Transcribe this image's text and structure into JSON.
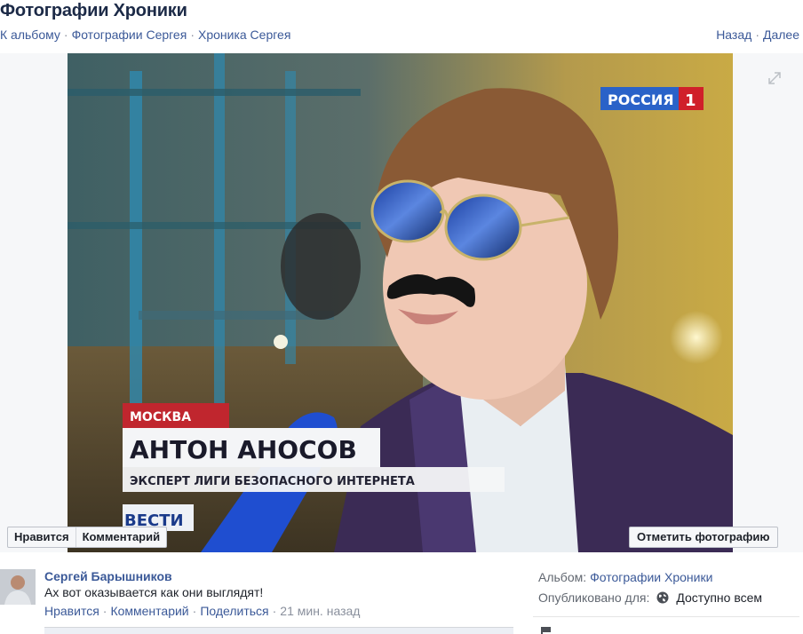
{
  "header": {
    "title": "Фотографии Хроники",
    "breadcrumbs": [
      "К альбому",
      "Фотографии Сергея",
      "Хроника Сергея"
    ],
    "nav_back": "Назад",
    "nav_next": "Далее"
  },
  "photo": {
    "channel_logo": "РОССИЯ",
    "channel_number": "1",
    "location": "МОСКВА",
    "person_name": "АНТОН АНОСОВ",
    "person_caption": "ЭКСПЕРТ ЛИГИ БЕЗОПАСНОГО ИНТЕРНЕТА",
    "program": "ВЕСТИ",
    "like_label": "Нравится",
    "comment_label": "Комментарий",
    "tag_label": "Отметить фотографию"
  },
  "comment": {
    "author": "Сергей Барышников",
    "text": "Ах вот оказывается как они выглядят!",
    "like": "Нравится",
    "comment": "Комментарий",
    "share": "Поделиться",
    "time": "21 мин. назад"
  },
  "info": {
    "album_label": "Альбом:",
    "album_name": "Фотографии Хроники",
    "published_label": "Опубликовано для:",
    "audience": "Доступно всем"
  },
  "icons": {
    "expand": "expand-icon",
    "globe": "globe-icon",
    "flag": "flag-icon"
  },
  "colors": {
    "link": "#3b5998",
    "title": "#1c2a47"
  }
}
